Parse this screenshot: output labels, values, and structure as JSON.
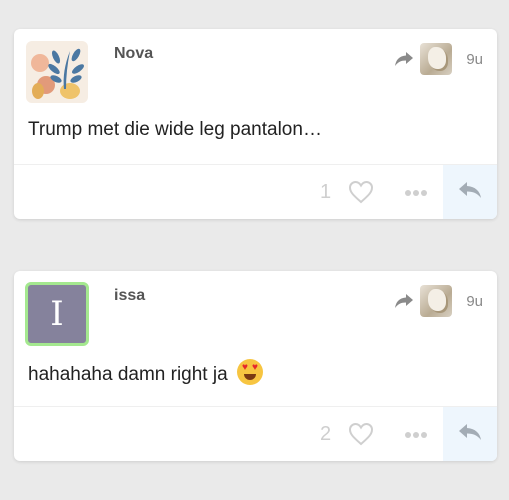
{
  "posts": [
    {
      "username": "Nova",
      "time": "9u",
      "text": "Trump met die wide leg pantalon…",
      "like_count": "1"
    },
    {
      "username": "issa",
      "avatar_letter": "I",
      "time": "9u",
      "text": "hahahaha damn right ja",
      "like_count": "2"
    }
  ],
  "colors": {
    "accent_reply_bg": "#eef6fd",
    "issa_avatar_bg": "#85829c",
    "issa_avatar_border": "#a4e88f"
  },
  "icons": [
    "share-arrow-icon",
    "heart-icon",
    "more-icon",
    "reply-icon",
    "heart-eyes-emoji"
  ]
}
